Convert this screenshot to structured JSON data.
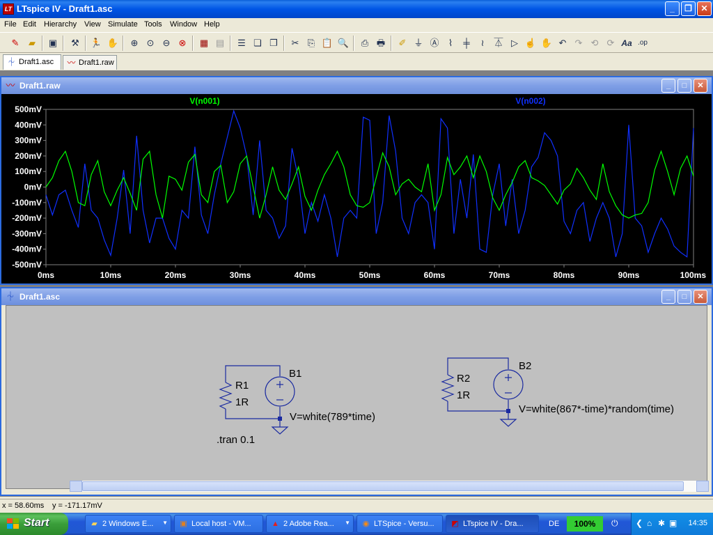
{
  "window": {
    "title": "LTspice IV - Draft1.asc"
  },
  "menu": [
    "File",
    "Edit",
    "Hierarchy",
    "View",
    "Simulate",
    "Tools",
    "Window",
    "Help"
  ],
  "tabs": [
    {
      "label": "Draft1.asc",
      "icon": "schematic-icon",
      "active": true
    },
    {
      "label": "Draft1.raw",
      "icon": "waveform-icon",
      "active": false
    }
  ],
  "plot_window": {
    "title": "Draft1.raw",
    "chart_data": {
      "type": "line",
      "xlabel": "",
      "ylabel": "",
      "xlim": [
        0,
        100
      ],
      "ylim": [
        -500,
        500
      ],
      "x_tick_labels": [
        "0ms",
        "10ms",
        "20ms",
        "30ms",
        "40ms",
        "50ms",
        "60ms",
        "70ms",
        "80ms",
        "90ms",
        "100ms"
      ],
      "y_tick_labels": [
        "500mV",
        "400mV",
        "300mV",
        "200mV",
        "100mV",
        "0mV",
        "-100mV",
        "-200mV",
        "-300mV",
        "-400mV",
        "-500mV"
      ],
      "grid": false,
      "series": [
        {
          "name": "V(n001)",
          "color": "#00ff00",
          "x": [
            0,
            1,
            2,
            3,
            4,
            5,
            6,
            7,
            8,
            9,
            10,
            11,
            12,
            13,
            14,
            15,
            16,
            17,
            18,
            19,
            20,
            21,
            22,
            23,
            24,
            25,
            26,
            27,
            28,
            29,
            30,
            31,
            32,
            33,
            34,
            35,
            36,
            37,
            38,
            39,
            40,
            41,
            42,
            43,
            44,
            45,
            46,
            47,
            48,
            49,
            50,
            51,
            52,
            53,
            54,
            55,
            56,
            57,
            58,
            59,
            60,
            61,
            62,
            63,
            64,
            65,
            66,
            67,
            68,
            69,
            70,
            71,
            72,
            73,
            74,
            75,
            76,
            77,
            78,
            79,
            80,
            81,
            82,
            83,
            84,
            85,
            86,
            87,
            88,
            89,
            90,
            91,
            92,
            93,
            94,
            95,
            96,
            97,
            98,
            99,
            100
          ],
          "y": [
            0,
            60,
            170,
            230,
            100,
            -100,
            -120,
            80,
            170,
            -30,
            -120,
            -20,
            60,
            -40,
            -150,
            180,
            230,
            -50,
            -200,
            70,
            50,
            -20,
            160,
            210,
            -50,
            -100,
            100,
            140,
            -100,
            -30,
            150,
            200,
            0,
            -200,
            -50,
            130,
            -20,
            -80,
            20,
            130,
            -60,
            -150,
            -20,
            80,
            150,
            230,
            130,
            -50,
            -120,
            -130,
            -100,
            60,
            220,
            130,
            -50,
            20,
            50,
            0,
            -30,
            150,
            -150,
            -50,
            190,
            80,
            130,
            200,
            60,
            200,
            100,
            -70,
            -150,
            -50,
            30,
            130,
            170,
            60,
            40,
            10,
            -50,
            -110,
            -20,
            20,
            120,
            60,
            -20,
            -80,
            150,
            -30,
            -120,
            -180,
            -200,
            -180,
            -170,
            -100,
            110,
            230,
            100,
            -50,
            120,
            200,
            70
          ]
        },
        {
          "name": "V(n002)",
          "color": "#1030ff",
          "x": [
            0,
            1,
            2,
            3,
            4,
            5,
            6,
            7,
            8,
            9,
            10,
            11,
            12,
            13,
            14,
            15,
            16,
            17,
            18,
            19,
            20,
            21,
            22,
            23,
            24,
            25,
            26,
            27,
            28,
            29,
            30,
            31,
            32,
            33,
            34,
            35,
            36,
            37,
            38,
            39,
            40,
            41,
            42,
            43,
            44,
            45,
            46,
            47,
            48,
            49,
            50,
            51,
            52,
            53,
            54,
            55,
            56,
            57,
            58,
            59,
            60,
            61,
            62,
            63,
            64,
            65,
            66,
            67,
            68,
            69,
            70,
            71,
            72,
            73,
            74,
            75,
            76,
            77,
            78,
            79,
            80,
            81,
            82,
            83,
            84,
            85,
            86,
            87,
            88,
            89,
            90,
            91,
            92,
            93,
            94,
            95,
            96,
            97,
            98,
            99,
            100
          ],
          "y": [
            -50,
            -180,
            -50,
            -20,
            -150,
            -260,
            150,
            -150,
            -200,
            -340,
            -440,
            -200,
            110,
            -300,
            330,
            -150,
            -360,
            -200,
            -200,
            -330,
            -400,
            -150,
            -200,
            260,
            -180,
            -300,
            -50,
            150,
            320,
            490,
            380,
            200,
            -180,
            300,
            -150,
            -200,
            -330,
            -250,
            250,
            50,
            -300,
            -100,
            -220,
            -50,
            -200,
            -450,
            -200,
            -150,
            -200,
            450,
            430,
            -300,
            -100,
            460,
            230,
            -200,
            -300,
            -100,
            -50,
            -100,
            -400,
            440,
            380,
            -300,
            50,
            -200,
            210,
            -400,
            -420,
            -50,
            150,
            -250,
            50,
            -300,
            -150,
            130,
            190,
            350,
            300,
            200,
            -220,
            -300,
            -150,
            -100,
            -350,
            -200,
            -100,
            -200,
            -450,
            -300,
            400,
            -200,
            -250,
            -420,
            -300,
            -200,
            -270,
            -380,
            -420,
            -450,
            380
          ]
        }
      ]
    }
  },
  "schematic_window": {
    "title": "Draft1.asc",
    "components": {
      "r1_name": "R1",
      "r1_value": "1R",
      "b1_name": "B1",
      "b1_expr": "V=white(789*time)",
      "r2_name": "R2",
      "r2_value": "1R",
      "b2_name": "B2",
      "b2_expr": "V=white(867*-time)*random(time)",
      "directive": ".tran 0.1"
    }
  },
  "status": {
    "x_readout": "x = 58.60ms",
    "y_readout": "y = -171.17mV"
  },
  "taskbar": {
    "start_label": "Start",
    "tasks": [
      {
        "label": "2 Windows E...",
        "icon": "folder-icon",
        "active": false
      },
      {
        "label": "Local host - VM...",
        "icon": "vm-icon",
        "active": false
      },
      {
        "label": "2 Adobe Rea...",
        "icon": "adobe-icon",
        "active": false
      },
      {
        "label": "LTSpice - Versu...",
        "icon": "firefox-icon",
        "active": false
      },
      {
        "label": "LTspice IV - Dra...",
        "icon": "ltspice-icon",
        "active": true
      }
    ],
    "language": "DE",
    "zoom": "100%",
    "clock": "14:35"
  }
}
